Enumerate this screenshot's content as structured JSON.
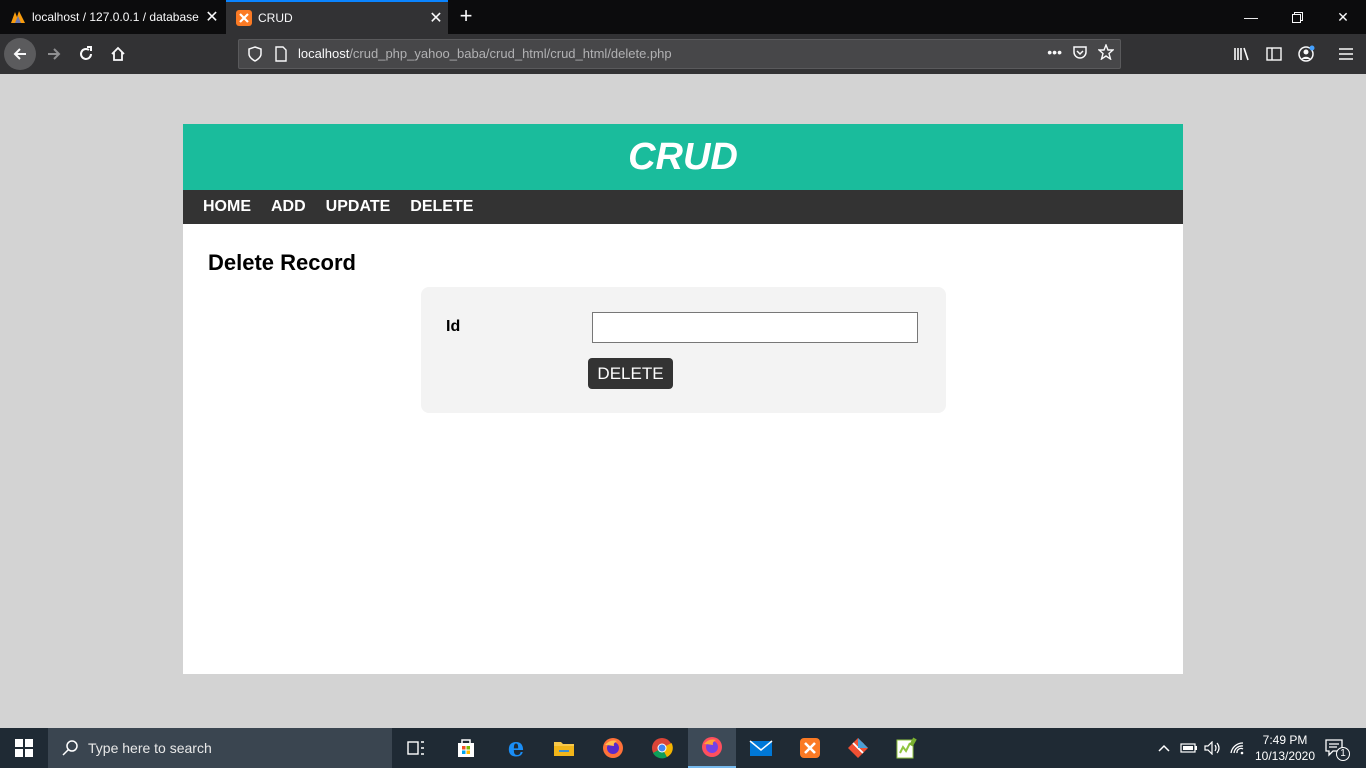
{
  "browser": {
    "tabs": [
      {
        "title": "localhost / 127.0.0.1 / database",
        "favicon": "phpmyadmin-icon",
        "active": false
      },
      {
        "title": "CRUD",
        "favicon": "xampp-icon",
        "active": true
      }
    ],
    "url": {
      "host": "localhost",
      "path": "/crud_php_yahoo_baba/crud_html/crud_html/delete.php"
    }
  },
  "site": {
    "title": "CRUD",
    "menu": [
      "HOME",
      "ADD",
      "UPDATE",
      "DELETE"
    ],
    "page_heading": "Delete Record",
    "form": {
      "id_label": "Id",
      "id_value": "",
      "submit_label": "DELETE"
    },
    "colors": {
      "header": "#1abc9c",
      "menu": "#333333",
      "background": "#d3d3d3"
    }
  },
  "taskbar": {
    "search_placeholder": "Type here to search",
    "time": "7:49 PM",
    "date": "10/13/2020",
    "notification_count": "1"
  }
}
